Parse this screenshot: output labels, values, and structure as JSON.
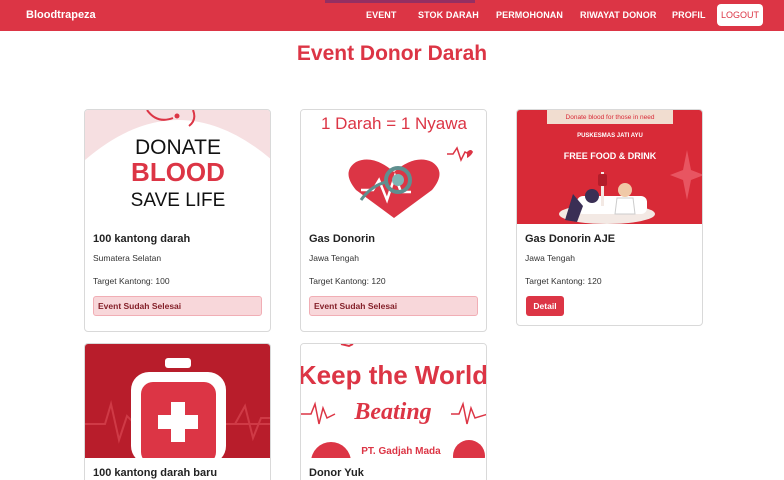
{
  "navbar": {
    "brand": "Bloodtrapeza",
    "items": [
      "EVENT",
      "STOK DARAH",
      "PERMOHONAN",
      "RIWAYAT DONOR",
      "PROFIL"
    ],
    "logout_label": "LOGOUT"
  },
  "page_title": "Event Donor Darah",
  "events": [
    {
      "title": "100 kantong darah",
      "region": "Sumatera Selatan",
      "target": "Target Kantong: 100",
      "status": "Event Sudah Selesai",
      "image_text": [
        "DONATE",
        "BLOOD",
        "SAVE LIFE"
      ]
    },
    {
      "title": "Gas Donorin",
      "region": "Jawa Tengah",
      "target": "Target Kantong: 120",
      "status": "Event Sudah Selesai",
      "image_text": [
        "1 Darah = 1 Nyawa"
      ]
    },
    {
      "title": "Gas Donorin AJE",
      "region": "Jawa Tengah",
      "target": "Target Kantong: 120",
      "action": "Detail",
      "image_text": [
        "Donate blood for those in need",
        "PUSKESMAS JATI AYU",
        "FREE FOOD & DRINK"
      ]
    },
    {
      "title": "100 kantong darah baru"
    },
    {
      "title": "Donor Yuk",
      "image_text": [
        "Keep the World",
        "Beating",
        "PT. Gadjah Mada"
      ]
    }
  ],
  "colors": {
    "primary": "#dc3545",
    "status_bg": "#f8d7da",
    "status_text": "#842029"
  }
}
